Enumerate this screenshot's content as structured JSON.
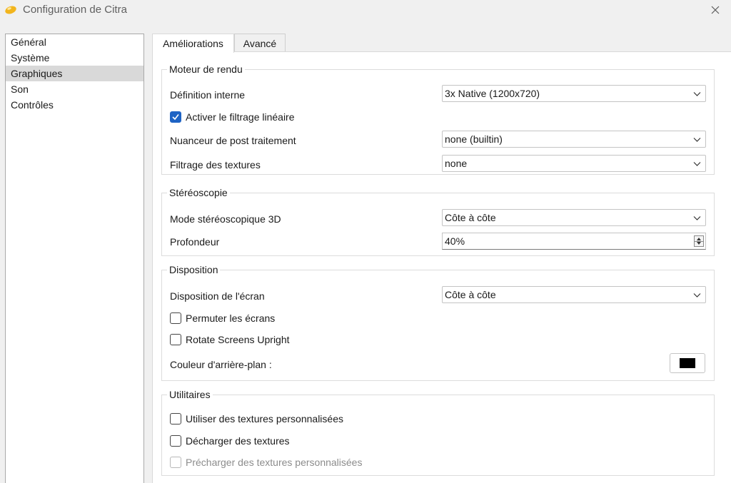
{
  "window": {
    "title": "Configuration de Citra"
  },
  "sidebar": {
    "items": [
      {
        "label": "Général"
      },
      {
        "label": "Système"
      },
      {
        "label": "Graphiques",
        "selected": true
      },
      {
        "label": "Son"
      },
      {
        "label": "Contrôles"
      }
    ]
  },
  "tabs": [
    {
      "label": "Améliorations",
      "active": true
    },
    {
      "label": "Avancé",
      "active": false
    }
  ],
  "groups": {
    "rendu": {
      "title": "Moteur de rendu",
      "resolution_label": "Définition interne",
      "resolution_value": "3x Native (1200x720)",
      "linear_filter_label": "Activer le filtrage linéaire",
      "linear_filter_checked": true,
      "shader_label": "Nuanceur de post traitement",
      "shader_value": "none (builtin)",
      "texture_filter_label": "Filtrage des textures",
      "texture_filter_value": "none"
    },
    "stereo": {
      "title": "Stéréoscopie",
      "mode_label": "Mode stéréoscopique 3D",
      "mode_value": "Côte à côte",
      "depth_label": "Profondeur",
      "depth_value": "40%"
    },
    "layout": {
      "title": "Disposition",
      "screen_layout_label": "Disposition de l'écran",
      "screen_layout_value": "Côte à côte",
      "swap_label": "Permuter les écrans",
      "swap_checked": false,
      "rotate_label": "Rotate Screens Upright",
      "rotate_checked": false,
      "bg_color_label": "Couleur d'arrière-plan :",
      "bg_color_value": "#000000"
    },
    "utilities": {
      "title": "Utilitaires",
      "custom_textures_label": "Utiliser des textures personnalisées",
      "custom_textures_checked": false,
      "dump_textures_label": "Décharger des textures",
      "dump_textures_checked": false,
      "preload_label": "Précharger des textures personnalisées",
      "preload_checked": false,
      "preload_disabled": true
    }
  },
  "colors": {
    "accent": "#1e63c4",
    "selected_item": "#d9d9d9",
    "panel": "#ffffff",
    "window_bg": "#f0f0f0"
  }
}
